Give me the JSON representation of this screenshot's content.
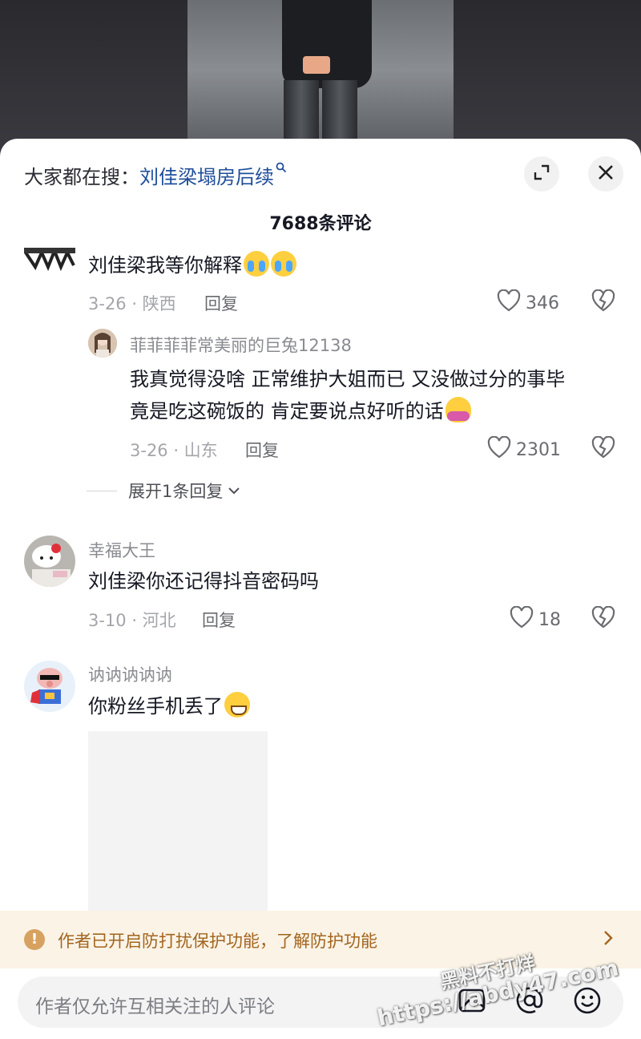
{
  "hot_search": {
    "prefix": "大家都在搜：",
    "query": "刘佳梁塌房后续"
  },
  "comment_count": "7688条评论",
  "comments": [
    {
      "username": "",
      "text": "刘佳梁我等你解释",
      "date_location": "3-26 · 陕西",
      "reply_label": "回复",
      "likes": "346",
      "emojis": [
        "cry",
        "cry"
      ],
      "replies": [
        {
          "username": "菲菲菲菲常美丽的巨兔12138",
          "text_line1": "我真觉得没啥 正常维护大姐而已 又没做过分的事毕",
          "text_line2": "竟是吃这碗饭的 肯定要说点好听的话",
          "date_location": "3-26 · 山东",
          "reply_label": "回复",
          "likes": "2301",
          "emojis": [
            "hug"
          ]
        }
      ],
      "expand_label": "展开1条回复"
    },
    {
      "username": "幸福大王",
      "text": "刘佳梁你还记得抖音密码吗",
      "date_location": "3-10 · 河北",
      "reply_label": "回复",
      "likes": "18"
    },
    {
      "username": "讷讷讷讷讷",
      "text": "你粉丝手机丢了",
      "emojis": [
        "grin"
      ]
    }
  ],
  "banner": {
    "text": "作者已开启防打扰保护功能，了解防护功能"
  },
  "input": {
    "placeholder": "作者仅允许互相关注的人评论"
  },
  "icons": [
    "expand-icon",
    "close-icon",
    "search-icon",
    "heart-icon",
    "dislike-icon",
    "chevron-down-icon",
    "warning-icon",
    "chevron-right-icon",
    "image-icon",
    "at-icon",
    "emoji-icon"
  ],
  "watermark": {
    "line1": "黑料不打烊",
    "line2": "https://abdy47.com"
  },
  "colors": {
    "link": "#1e4e9a",
    "banner_bg": "#fbf3e6",
    "banner_text": "#a2651f"
  }
}
